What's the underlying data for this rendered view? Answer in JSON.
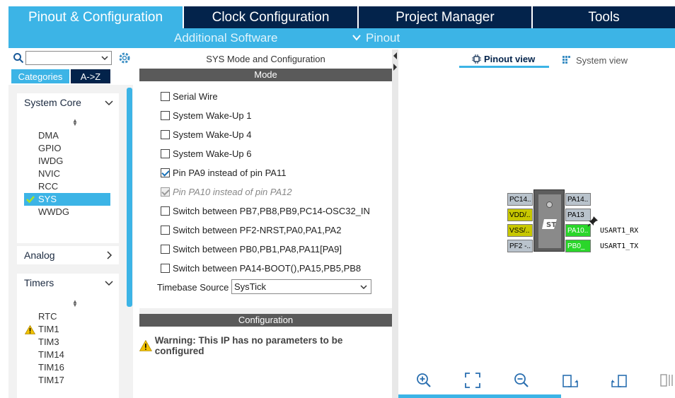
{
  "tabs": {
    "pinout": "Pinout & Configuration",
    "clock": "Clock Configuration",
    "project": "Project Manager",
    "tools": "Tools"
  },
  "subbar": {
    "additional": "Additional Software",
    "pinout": "Pinout"
  },
  "left": {
    "search_value": "",
    "categories_tab": "Categories",
    "az_tab": "A->Z",
    "system_core": {
      "title": "System Core",
      "items": [
        "DMA",
        "GPIO",
        "IWDG",
        "NVIC",
        "RCC",
        "SYS",
        "WWDG"
      ],
      "selected": "SYS"
    },
    "analog": {
      "title": "Analog"
    },
    "timers": {
      "title": "Timers",
      "items": [
        "RTC",
        "TIM1",
        "TIM3",
        "TIM14",
        "TIM16",
        "TIM17"
      ],
      "warning_item": "TIM1"
    }
  },
  "mid": {
    "title": "SYS Mode and Configuration",
    "mode_header": "Mode",
    "options": [
      {
        "label": "Serial Wire",
        "checked": false,
        "disabled": false
      },
      {
        "label": "System Wake-Up 1",
        "checked": false,
        "disabled": false
      },
      {
        "label": "System Wake-Up 4",
        "checked": false,
        "disabled": false
      },
      {
        "label": "System Wake-Up 6",
        "checked": false,
        "disabled": false
      },
      {
        "label": "Pin PA9 instead of pin PA11",
        "checked": true,
        "disabled": false
      },
      {
        "label": "Pin PA10 instead of pin PA12",
        "checked": true,
        "disabled": true
      },
      {
        "label": "Switch between PB7,PB8,PB9,PC14-OSC32_IN",
        "checked": false,
        "disabled": false
      },
      {
        "label": "Switch between PF2-NRST,PA0,PA1,PA2",
        "checked": false,
        "disabled": false
      },
      {
        "label": "Switch between PB0,PB1,PA8,PA11[PA9]",
        "checked": false,
        "disabled": false
      },
      {
        "label": "Switch between PA14-BOOT(),PA15,PB5,PB8",
        "checked": false,
        "disabled": false
      }
    ],
    "timebase_label": "Timebase Source",
    "timebase_value": "SysTick",
    "config_header": "Configuration",
    "warning": "Warning: This IP has no parameters to be configured"
  },
  "right": {
    "pinout_view": "Pinout view",
    "system_view": "System view",
    "pins_left": [
      "PC14..",
      "VDD/..",
      "VSS/..",
      "PF2 -.."
    ],
    "pins_right": [
      "PA14..",
      "PA13",
      "PA10..",
      "PB0_"
    ],
    "signals": [
      "USART1_RX",
      "USART1_TX"
    ]
  },
  "colors": {
    "navy": "#03234b",
    "accent": "#3cb4e6",
    "pin_gray": "#b9c3cc",
    "pin_yellow": "#c8c800",
    "pin_green": "#2ad62a"
  }
}
